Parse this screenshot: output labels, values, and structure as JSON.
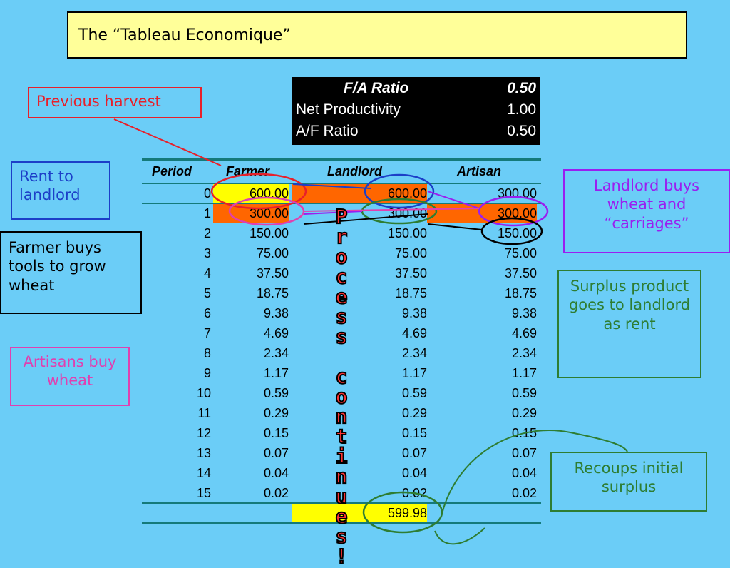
{
  "title": "The “Tableau Economique”",
  "ratios": [
    {
      "label": "F/A Ratio",
      "value": "0.50"
    },
    {
      "label": "Net Productivity",
      "value": "1.00"
    },
    {
      "label": "A/F Ratio",
      "value": "0.50"
    }
  ],
  "table": {
    "headers": {
      "period": "Period",
      "farmer": "Farmer",
      "landlord": "Landlord",
      "artisan": "Artisan"
    },
    "rows": [
      [
        "0",
        "600.00",
        "600.00",
        "300.00"
      ],
      [
        "1",
        "300.00",
        "300.00",
        "300.00"
      ],
      [
        "2",
        "150.00",
        "150.00",
        "150.00"
      ],
      [
        "3",
        "75.00",
        "75.00",
        "75.00"
      ],
      [
        "4",
        "37.50",
        "37.50",
        "37.50"
      ],
      [
        "5",
        "18.75",
        "18.75",
        "18.75"
      ],
      [
        "6",
        "9.38",
        "9.38",
        "9.38"
      ],
      [
        "7",
        "4.69",
        "4.69",
        "4.69"
      ],
      [
        "8",
        "2.34",
        "2.34",
        "2.34"
      ],
      [
        "9",
        "1.17",
        "1.17",
        "1.17"
      ],
      [
        "10",
        "0.59",
        "0.59",
        "0.59"
      ],
      [
        "11",
        "0.29",
        "0.29",
        "0.29"
      ],
      [
        "12",
        "0.15",
        "0.15",
        "0.15"
      ],
      [
        "13",
        "0.07",
        "0.07",
        "0.07"
      ],
      [
        "14",
        "0.04",
        "0.04",
        "0.04"
      ],
      [
        "15",
        "0.02",
        "0.02",
        "0.02"
      ]
    ],
    "total": "599.98"
  },
  "vertical_text": "Process continues!",
  "callouts": {
    "previous_harvest": "Previous harvest",
    "rent_to_landlord": "Rent to landlord",
    "farmer_buys_tools": "Farmer buys tools to grow wheat",
    "artisans_buy_wheat": "Artisans buy wheat",
    "landlord_buys": "Landlord buys wheat and “carriages”",
    "surplus_product": "Surplus product goes to landlord as rent",
    "recoups_surplus": "Recoups initial surplus"
  },
  "colors": {
    "background": "#6bcdf7",
    "title_bg": "#ffff99",
    "highlight_yellow": "#ffff00",
    "highlight_orange": "#ff6600",
    "red": "#e8202a",
    "blue": "#1c3fc8",
    "purple": "#9a1ff0",
    "green": "#2e7d32",
    "pink": "#e040b0"
  }
}
